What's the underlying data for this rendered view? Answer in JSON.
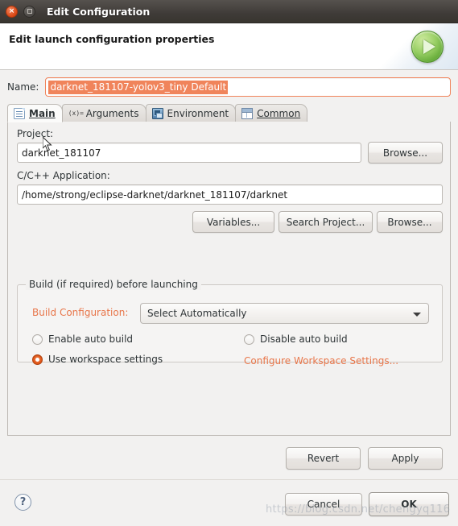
{
  "window": {
    "title": "Edit Configuration",
    "close_label": "×",
    "maximize_label": ""
  },
  "banner": {
    "title": "Edit launch configuration properties",
    "run_icon": "run-play-icon"
  },
  "name_field": {
    "label": "Name:",
    "value": "darknet_181107-yolov3_tiny Default",
    "selected": true
  },
  "tabs": [
    {
      "label": "Main",
      "icon": "document-icon",
      "active": true,
      "mnemonic": "M"
    },
    {
      "label": "Arguments",
      "icon": "variable-icon",
      "active": false
    },
    {
      "label": "Environment",
      "icon": "environment-monitor-icon",
      "active": false
    },
    {
      "label": "Common",
      "icon": "window-icon",
      "active": false,
      "mnemonic": "C"
    }
  ],
  "main_tab": {
    "project": {
      "label": "Project:",
      "value": "darknet_181107",
      "browse_label": "Browse..."
    },
    "application": {
      "label": "C/C++ Application:",
      "value": "/home/strong/eclipse-darknet/darknet_181107/darknet",
      "buttons": [
        {
          "label": "Variables..."
        },
        {
          "label": "Search Project..."
        },
        {
          "label": "Browse..."
        }
      ]
    },
    "build_group": {
      "title": "Build (if required) before launching",
      "build_configuration_label": "Build Configuration:",
      "build_configuration_value": "Select Automatically",
      "radios": [
        {
          "label": "Enable auto build",
          "checked": false
        },
        {
          "label": "Disable auto build",
          "checked": false
        },
        {
          "label": "Use workspace settings",
          "checked": true
        }
      ],
      "configure_link": "Configure Workspace Settings..."
    }
  },
  "actions": {
    "revert": "Revert",
    "apply": "Apply",
    "cancel": "Cancel",
    "ok": "OK",
    "help": "?"
  },
  "watermark": "https://blog.csdn.net/chengyq116",
  "colors": {
    "accent_orange": "#e8764a",
    "selection": "#f0845b",
    "titlebar": "#3f3b38",
    "panel_bg": "#f2f1f0"
  }
}
